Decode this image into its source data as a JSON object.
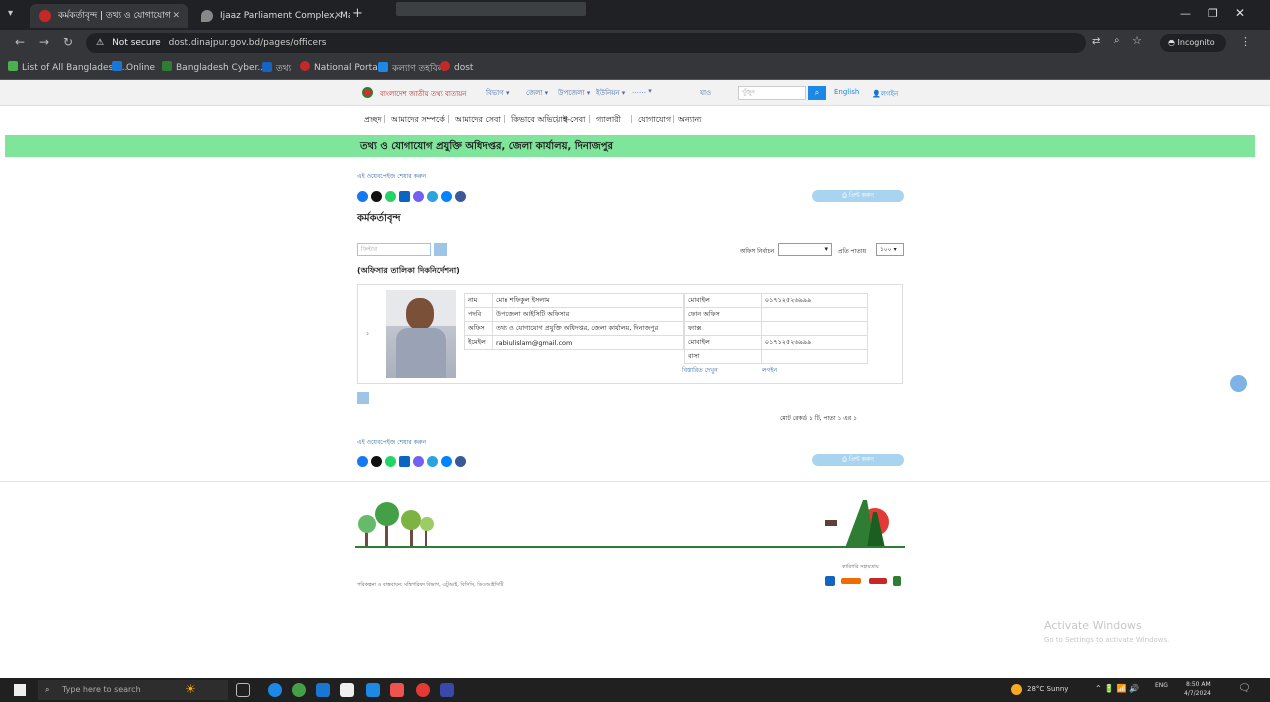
{
  "browser": {
    "tabs": [
      {
        "label": "কর্মকর্তাবৃন্দ | তথ্য ও যোগাযোগ",
        "active": true
      },
      {
        "label": "Ijaaz Parliament Complex, Man"
      }
    ],
    "address": {
      "security": "Not secure",
      "url": "dost.dinajpur.gov.bd/pages/officers"
    },
    "incognito_label": "Incognito",
    "bookmarks": [
      "List of All Bangladesh...",
      "Online",
      "Bangladesh Cyber...",
      "তথ্য",
      "National Portal",
      "কল্যাণ তহবিল",
      "dost"
    ]
  },
  "site": {
    "portal_name": "বাংলাদেশ জাতীয় তথ্য বাতায়ন",
    "selectors": [
      "বিভাগ",
      "জেলা",
      "উপজেলা",
      "ইউনিয়ন"
    ],
    "go_label": "যাও",
    "search_placeholder": "খুঁজুন",
    "lang_en": "English",
    "lang_login": "লগইন",
    "nav": [
      "প্রচ্ছদ",
      "আমাদের সম্পর্কে",
      "আমাদের সেবা",
      "কিভাবে অভিযোগ",
      "ই-সেবা",
      "গ্যালারী",
      "যোগাযোগ",
      "অন্যান্য"
    ],
    "banner": "তথ্য ও যোগাযোগ প্রযুক্তি অধিদপ্তর, জেলা কার্যালয়, দিনাজপুর",
    "share_label": "এই ওয়েবপেইজ শেয়ার করুন",
    "print_label": "প্রিন্ট করুন",
    "page_title": "কর্মকর্তাবৃন্দ",
    "filter_placeholder": "ফিল্টার",
    "office_select_label": "অফিস নির্বাচন",
    "per_page_label": "প্রতি পাতায়",
    "per_page_value": "১০০",
    "section_title": "(অফিসার তালিকা দিকনির্দেশনা)",
    "officer": {
      "rows_left": [
        {
          "label": "নাম",
          "value": "মোঃ শফিকুল ইসলাম"
        },
        {
          "label": "পদবি",
          "value": "উপজেলা আইসিটি অফিসার"
        },
        {
          "label": "অফিস",
          "value": "তথ্য ও যোগাযোগ প্রযুক্তি অধিদপ্তর, জেলা কার্যালয়, দিনাজপুর"
        },
        {
          "label": "ইমেইল",
          "value": "rabiulislam@gmail.com"
        }
      ],
      "rows_right": [
        {
          "label": "মোবাইল",
          "value": "০১৭১২৫২৬৯৯৯"
        },
        {
          "label": "ফোন অফিস",
          "value": ""
        },
        {
          "label": "ফ্যাক্স",
          "value": ""
        },
        {
          "label": "মোবাইল",
          "value": "০১৭১২৫২৬৯৯৯"
        },
        {
          "label": "বাসা",
          "value": ""
        }
      ],
      "details_link": "বিস্তারিত দেখুন",
      "login_link": "লগইন"
    },
    "pagination_info": "মোট রেকর্ড ১ টি, পাতা ১ এর ১",
    "footer_left": "পরিকল্পনা ও বাস্তবায়ন: মন্ত্রিপরিষদ বিভাগ, এটুআই, বিসিসি, ডিওআইসিটি",
    "footer_partners": "কারিগরি সহায়তায়"
  },
  "windows": {
    "activate_title": "Activate Windows",
    "activate_sub": "Go to Settings to activate Windows."
  },
  "taskbar": {
    "search_placeholder": "Type here to search",
    "weather": "28°C  Sunny",
    "lang": "ENG",
    "time": "8:50 AM",
    "date": "4/7/2024"
  }
}
